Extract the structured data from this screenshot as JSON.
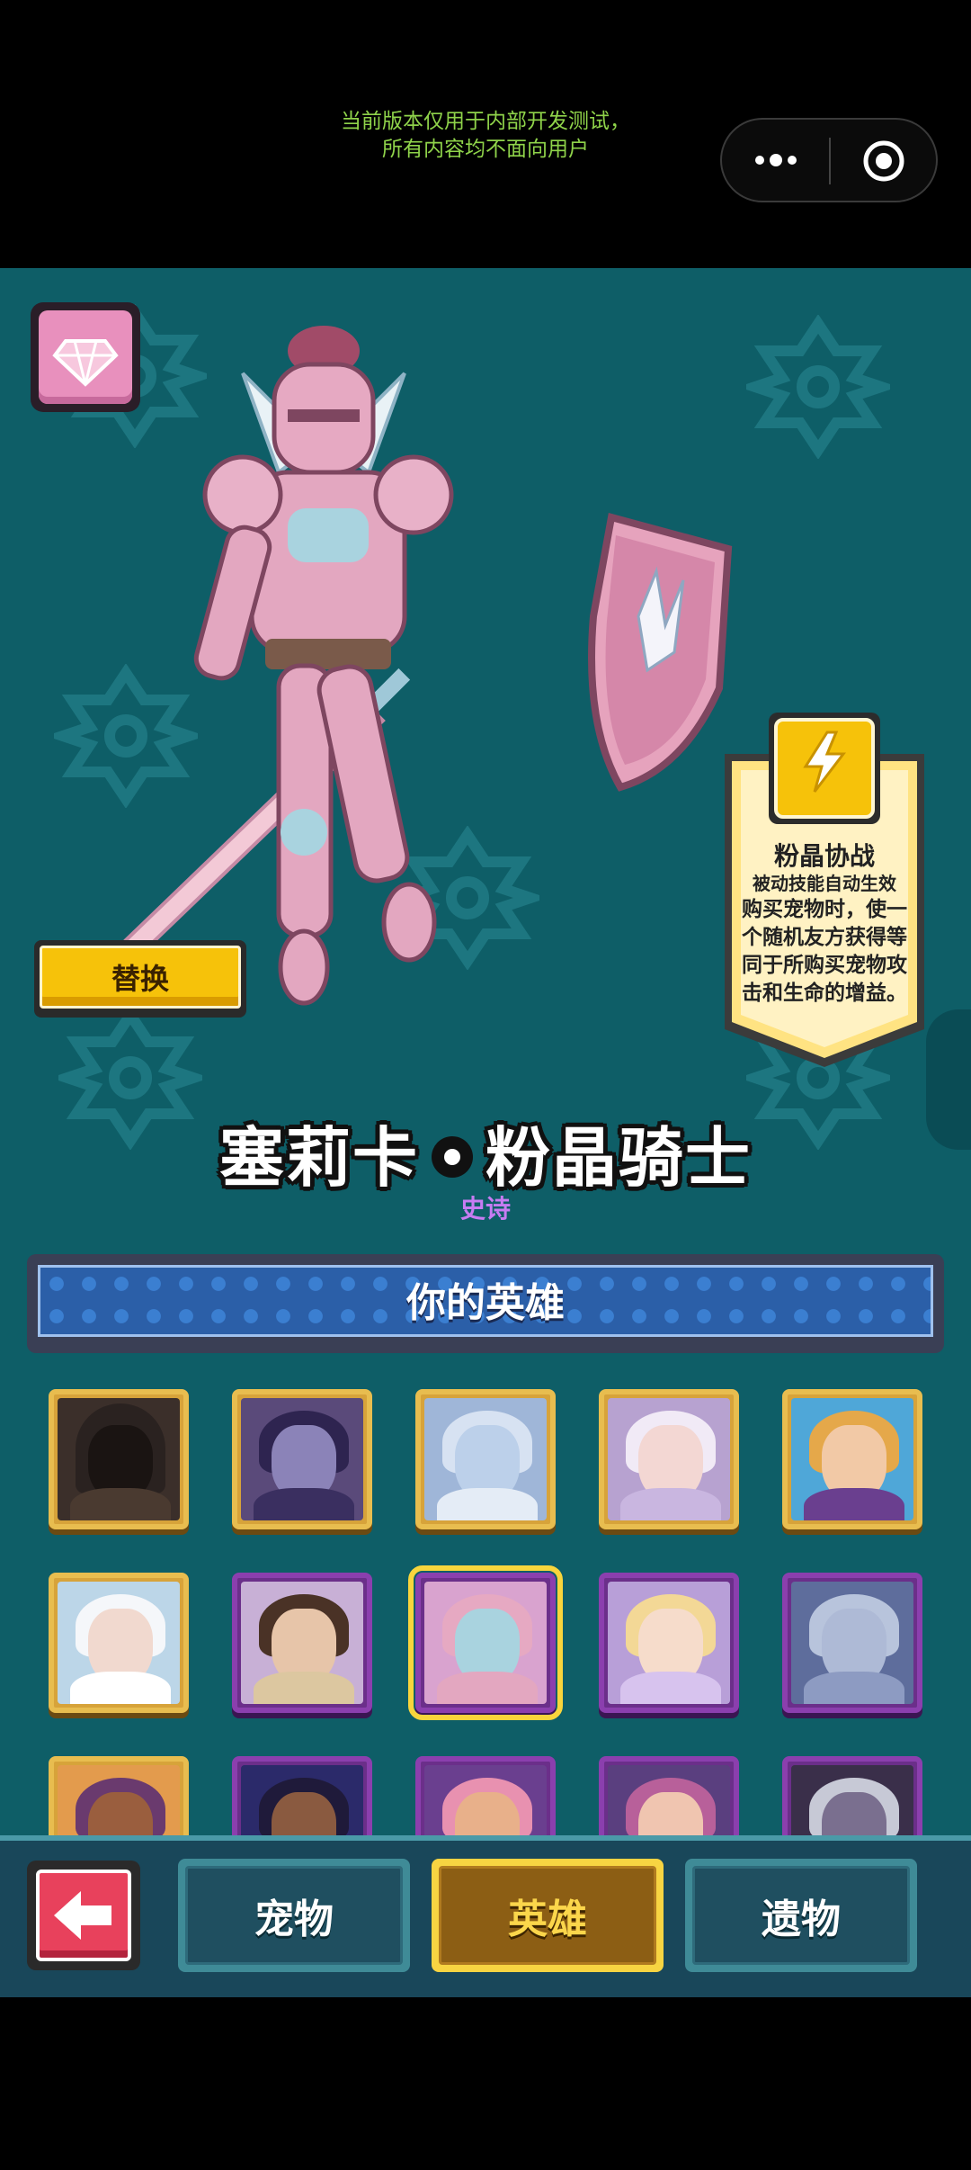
{
  "system_notice": {
    "line1": "当前版本仅用于内部开发测试，",
    "line2": "所有内容均不面向用户"
  },
  "capsule": {
    "more_icon": "more-dots-icon",
    "close_icon": "target-circle-icon"
  },
  "hero": {
    "name_left": "塞莉卡",
    "name_right": "粉晶骑士",
    "rarity": "史诗",
    "replace_label": "替换"
  },
  "skill": {
    "icon": "lightning-icon",
    "title": "粉晶协战",
    "subtitle": "被动技能自动生效",
    "description_lines": [
      "购买宠物时，使一",
      "个随机友方获得等",
      "同于所购买宠物攻",
      "击和生命的增益。"
    ]
  },
  "section": {
    "title": "你的英雄"
  },
  "heroes": [
    {
      "id": "hooded-rogue",
      "frame": "gold"
    },
    {
      "id": "purple-horned-elf",
      "frame": "gold"
    },
    {
      "id": "pale-light-elf",
      "frame": "gold"
    },
    {
      "id": "crowned-elf-queen",
      "frame": "gold"
    },
    {
      "id": "butterfly-boy",
      "frame": "gold"
    },
    {
      "id": "cloud-maiden",
      "frame": "gold"
    },
    {
      "id": "antlered-lady",
      "frame": "purple"
    },
    {
      "id": "pink-crystal-knight",
      "frame": "purple",
      "selected": true
    },
    {
      "id": "blonde-fairy",
      "frame": "purple"
    },
    {
      "id": "silver-spirit",
      "frame": "purple"
    },
    {
      "id": "jeweled-elf",
      "frame": "gold"
    },
    {
      "id": "starry-sorceress",
      "frame": "purple"
    },
    {
      "id": "pink-bearded-dwarf",
      "frame": "purple"
    },
    {
      "id": "pink-princess",
      "frame": "purple"
    },
    {
      "id": "dark-winged-fairy",
      "frame": "purple"
    }
  ],
  "nav": {
    "back_icon": "arrow-left-icon",
    "tabs": [
      {
        "label": "宠物",
        "active": false
      },
      {
        "label": "英雄",
        "active": true
      },
      {
        "label": "遗物",
        "active": false
      }
    ]
  },
  "colors": {
    "background": "#0e5e67",
    "accent_gold": "#f6c20a",
    "rarity_epic": "#c77cf2",
    "notice_green": "#8fd34a"
  }
}
